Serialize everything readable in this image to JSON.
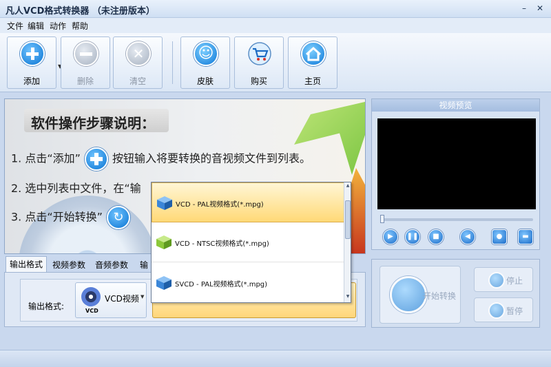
{
  "window": {
    "title": "凡人VCD格式转换器 （未注册版本）"
  },
  "menu": [
    "文件",
    "编辑",
    "动作",
    "帮助"
  ],
  "toolbar": {
    "add_label": "添加",
    "delete_label": "删除",
    "clear_label": "清空",
    "skin_label": "皮肤",
    "buy_label": "购买",
    "home_label": "主页"
  },
  "instructions": {
    "heading": "软件操作步骤说明：",
    "step1_a": "1. 点击“添加”",
    "step1_b": "按钮输入将要转换的音视频文件到列表。",
    "step2": "2. 选中列表中文件，在“输",
    "step3": "3. 点击“开始转换”"
  },
  "preview": {
    "title": "视频预览"
  },
  "tabs": [
    "输出格式",
    "视频参数",
    "音频参数",
    "输出"
  ],
  "output": {
    "label": "输出格式:",
    "format_value": "VCD视频",
    "format_icon_text": "VCD"
  },
  "dropdown": {
    "items": [
      {
        "label": "VCD - PAL视频格式(*.mpg)",
        "cube_color": "#3b86d8",
        "selected": true
      },
      {
        "label": "VCD - NTSC视频格式(*.mpg)",
        "cube_color": "#8cc83a",
        "selected": false
      },
      {
        "label": "SVCD - PAL视频格式(*.mpg)",
        "cube_color": "#3b86d8",
        "selected": false
      }
    ]
  },
  "actions": {
    "start_label": "开始转换",
    "stop_label": "停止",
    "pause_label": "暂停"
  },
  "colors": {
    "accent": "#0a74d2",
    "selection": "#ffd977"
  }
}
